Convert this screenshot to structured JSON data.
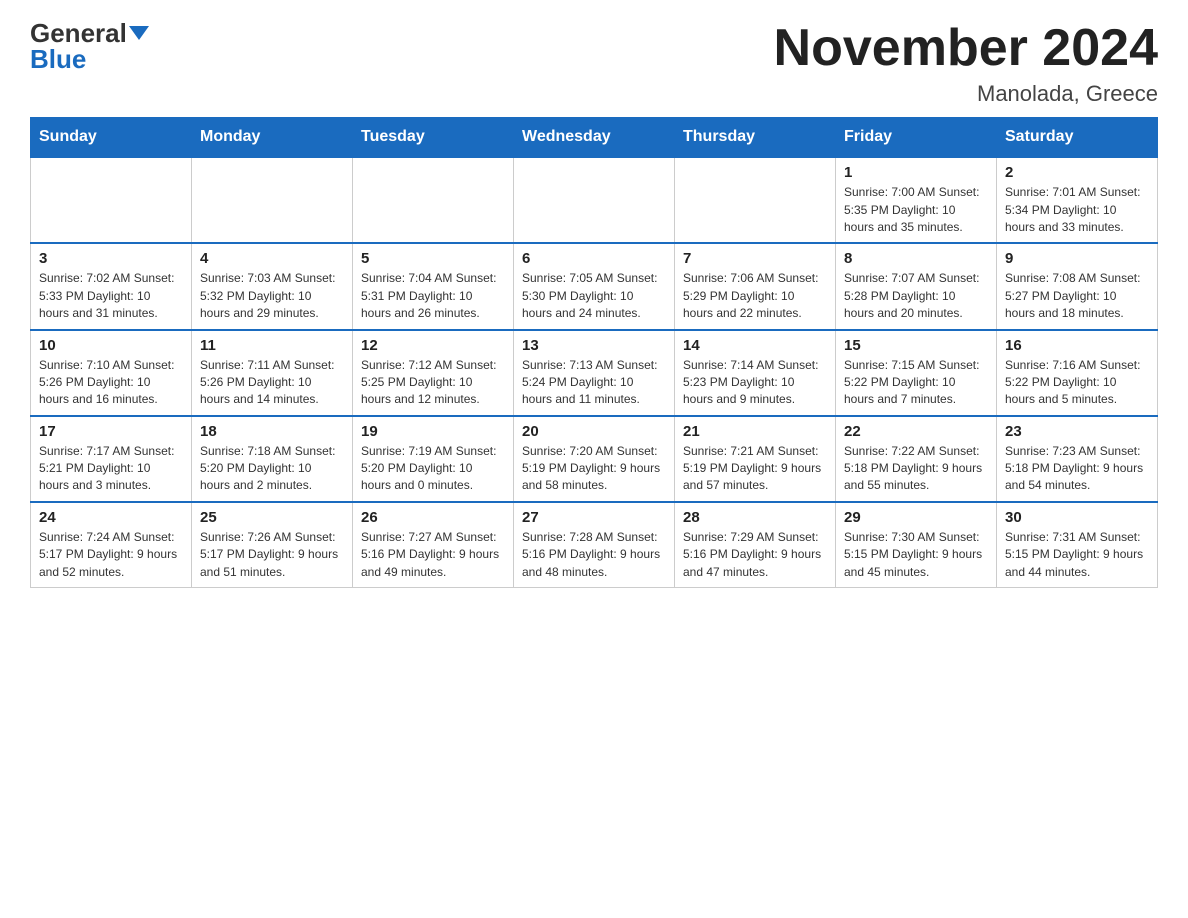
{
  "header": {
    "logo_general": "General",
    "logo_blue": "Blue",
    "month_title": "November 2024",
    "location": "Manolada, Greece"
  },
  "weekdays": [
    "Sunday",
    "Monday",
    "Tuesday",
    "Wednesday",
    "Thursday",
    "Friday",
    "Saturday"
  ],
  "weeks": [
    [
      {
        "day": "",
        "info": ""
      },
      {
        "day": "",
        "info": ""
      },
      {
        "day": "",
        "info": ""
      },
      {
        "day": "",
        "info": ""
      },
      {
        "day": "",
        "info": ""
      },
      {
        "day": "1",
        "info": "Sunrise: 7:00 AM\nSunset: 5:35 PM\nDaylight: 10 hours and 35 minutes."
      },
      {
        "day": "2",
        "info": "Sunrise: 7:01 AM\nSunset: 5:34 PM\nDaylight: 10 hours and 33 minutes."
      }
    ],
    [
      {
        "day": "3",
        "info": "Sunrise: 7:02 AM\nSunset: 5:33 PM\nDaylight: 10 hours and 31 minutes."
      },
      {
        "day": "4",
        "info": "Sunrise: 7:03 AM\nSunset: 5:32 PM\nDaylight: 10 hours and 29 minutes."
      },
      {
        "day": "5",
        "info": "Sunrise: 7:04 AM\nSunset: 5:31 PM\nDaylight: 10 hours and 26 minutes."
      },
      {
        "day": "6",
        "info": "Sunrise: 7:05 AM\nSunset: 5:30 PM\nDaylight: 10 hours and 24 minutes."
      },
      {
        "day": "7",
        "info": "Sunrise: 7:06 AM\nSunset: 5:29 PM\nDaylight: 10 hours and 22 minutes."
      },
      {
        "day": "8",
        "info": "Sunrise: 7:07 AM\nSunset: 5:28 PM\nDaylight: 10 hours and 20 minutes."
      },
      {
        "day": "9",
        "info": "Sunrise: 7:08 AM\nSunset: 5:27 PM\nDaylight: 10 hours and 18 minutes."
      }
    ],
    [
      {
        "day": "10",
        "info": "Sunrise: 7:10 AM\nSunset: 5:26 PM\nDaylight: 10 hours and 16 minutes."
      },
      {
        "day": "11",
        "info": "Sunrise: 7:11 AM\nSunset: 5:26 PM\nDaylight: 10 hours and 14 minutes."
      },
      {
        "day": "12",
        "info": "Sunrise: 7:12 AM\nSunset: 5:25 PM\nDaylight: 10 hours and 12 minutes."
      },
      {
        "day": "13",
        "info": "Sunrise: 7:13 AM\nSunset: 5:24 PM\nDaylight: 10 hours and 11 minutes."
      },
      {
        "day": "14",
        "info": "Sunrise: 7:14 AM\nSunset: 5:23 PM\nDaylight: 10 hours and 9 minutes."
      },
      {
        "day": "15",
        "info": "Sunrise: 7:15 AM\nSunset: 5:22 PM\nDaylight: 10 hours and 7 minutes."
      },
      {
        "day": "16",
        "info": "Sunrise: 7:16 AM\nSunset: 5:22 PM\nDaylight: 10 hours and 5 minutes."
      }
    ],
    [
      {
        "day": "17",
        "info": "Sunrise: 7:17 AM\nSunset: 5:21 PM\nDaylight: 10 hours and 3 minutes."
      },
      {
        "day": "18",
        "info": "Sunrise: 7:18 AM\nSunset: 5:20 PM\nDaylight: 10 hours and 2 minutes."
      },
      {
        "day": "19",
        "info": "Sunrise: 7:19 AM\nSunset: 5:20 PM\nDaylight: 10 hours and 0 minutes."
      },
      {
        "day": "20",
        "info": "Sunrise: 7:20 AM\nSunset: 5:19 PM\nDaylight: 9 hours and 58 minutes."
      },
      {
        "day": "21",
        "info": "Sunrise: 7:21 AM\nSunset: 5:19 PM\nDaylight: 9 hours and 57 minutes."
      },
      {
        "day": "22",
        "info": "Sunrise: 7:22 AM\nSunset: 5:18 PM\nDaylight: 9 hours and 55 minutes."
      },
      {
        "day": "23",
        "info": "Sunrise: 7:23 AM\nSunset: 5:18 PM\nDaylight: 9 hours and 54 minutes."
      }
    ],
    [
      {
        "day": "24",
        "info": "Sunrise: 7:24 AM\nSunset: 5:17 PM\nDaylight: 9 hours and 52 minutes."
      },
      {
        "day": "25",
        "info": "Sunrise: 7:26 AM\nSunset: 5:17 PM\nDaylight: 9 hours and 51 minutes."
      },
      {
        "day": "26",
        "info": "Sunrise: 7:27 AM\nSunset: 5:16 PM\nDaylight: 9 hours and 49 minutes."
      },
      {
        "day": "27",
        "info": "Sunrise: 7:28 AM\nSunset: 5:16 PM\nDaylight: 9 hours and 48 minutes."
      },
      {
        "day": "28",
        "info": "Sunrise: 7:29 AM\nSunset: 5:16 PM\nDaylight: 9 hours and 47 minutes."
      },
      {
        "day": "29",
        "info": "Sunrise: 7:30 AM\nSunset: 5:15 PM\nDaylight: 9 hours and 45 minutes."
      },
      {
        "day": "30",
        "info": "Sunrise: 7:31 AM\nSunset: 5:15 PM\nDaylight: 9 hours and 44 minutes."
      }
    ]
  ]
}
